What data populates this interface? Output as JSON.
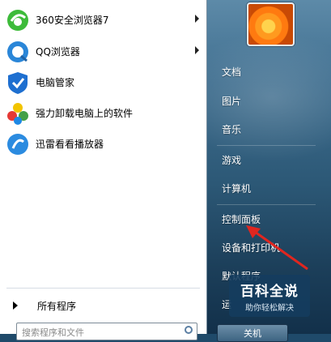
{
  "left_panel": {
    "pinned": [
      {
        "label": "360安全浏览器7",
        "icon": "360-browser-icon",
        "has_submenu": true
      },
      {
        "label": "QQ浏览器",
        "icon": "qq-browser-icon",
        "has_submenu": true
      },
      {
        "label": "电脑管家",
        "icon": "pc-manager-icon",
        "has_submenu": false
      },
      {
        "label": "强力卸载电脑上的软件",
        "icon": "uninstaller-icon",
        "has_submenu": false
      },
      {
        "label": "迅雷看看播放器",
        "icon": "xunlei-player-icon",
        "has_submenu": false
      }
    ],
    "all_programs_label": "所有程序",
    "search_placeholder": "搜索程序和文件"
  },
  "right_panel": {
    "items": [
      {
        "label": "文档"
      },
      {
        "label": "图片"
      },
      {
        "label": "音乐"
      },
      {
        "label": "游戏"
      },
      {
        "label": "计算机"
      },
      {
        "label": "控制面板"
      },
      {
        "label": "设备和打印机"
      },
      {
        "label": "默认程序"
      },
      {
        "label": "运"
      }
    ],
    "shutdown_label": "关机"
  },
  "watermark": {
    "title": "百科全说",
    "subtitle": "助你轻松解决"
  },
  "colors": {
    "accent": "#2c5876",
    "annotation_arrow": "#e0261f"
  }
}
